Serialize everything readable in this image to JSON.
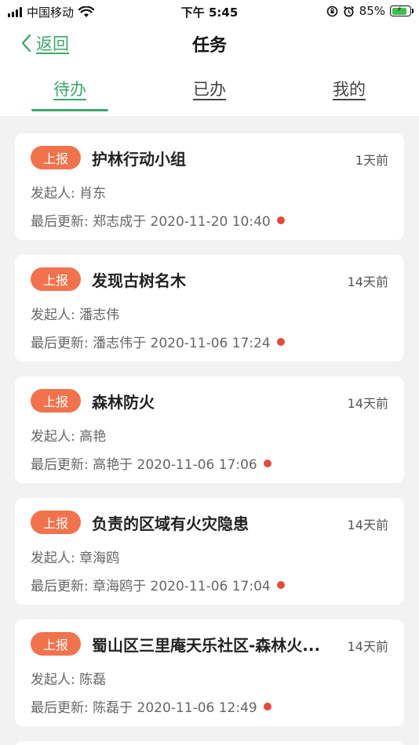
{
  "status_bar": {
    "carrier": "中国移动",
    "time": "下午 5:45",
    "battery": "85%",
    "battery_level": 0.85
  },
  "nav": {
    "back_label": "返回",
    "title": "任务"
  },
  "tabs": [
    {
      "label": "待办",
      "active": true
    },
    {
      "label": "已办",
      "active": false
    },
    {
      "label": "我的",
      "active": false
    }
  ],
  "tasks": [
    {
      "badge": "上报",
      "title": "护林行动小组",
      "time": "1天前",
      "initiator": "发起人: 肖东",
      "updated": "最后更新: 郑志成于 2020-11-20 10:40"
    },
    {
      "badge": "上报",
      "title": "发现古树名木",
      "time": "14天前",
      "initiator": "发起人: 潘志伟",
      "updated": "最后更新: 潘志伟于 2020-11-06 17:24"
    },
    {
      "badge": "上报",
      "title": "森林防火",
      "time": "14天前",
      "initiator": "发起人: 高艳",
      "updated": "最后更新: 高艳于 2020-11-06 17:06"
    },
    {
      "badge": "上报",
      "title": "负责的区域有火灾隐患",
      "time": "14天前",
      "initiator": "发起人: 章海鸥",
      "updated": "最后更新: 章海鸥于 2020-11-06 17:04"
    },
    {
      "badge": "上报",
      "title": "蜀山区三里庵天乐社区-森林火...",
      "time": "14天前",
      "initiator": "发起人: 陈磊",
      "updated": "最后更新: 陈磊于 2020-11-06 12:49"
    }
  ],
  "colors": {
    "accent": "#3ba86a",
    "badge": "#f0734d",
    "unread_dot": "#e34b3c"
  }
}
